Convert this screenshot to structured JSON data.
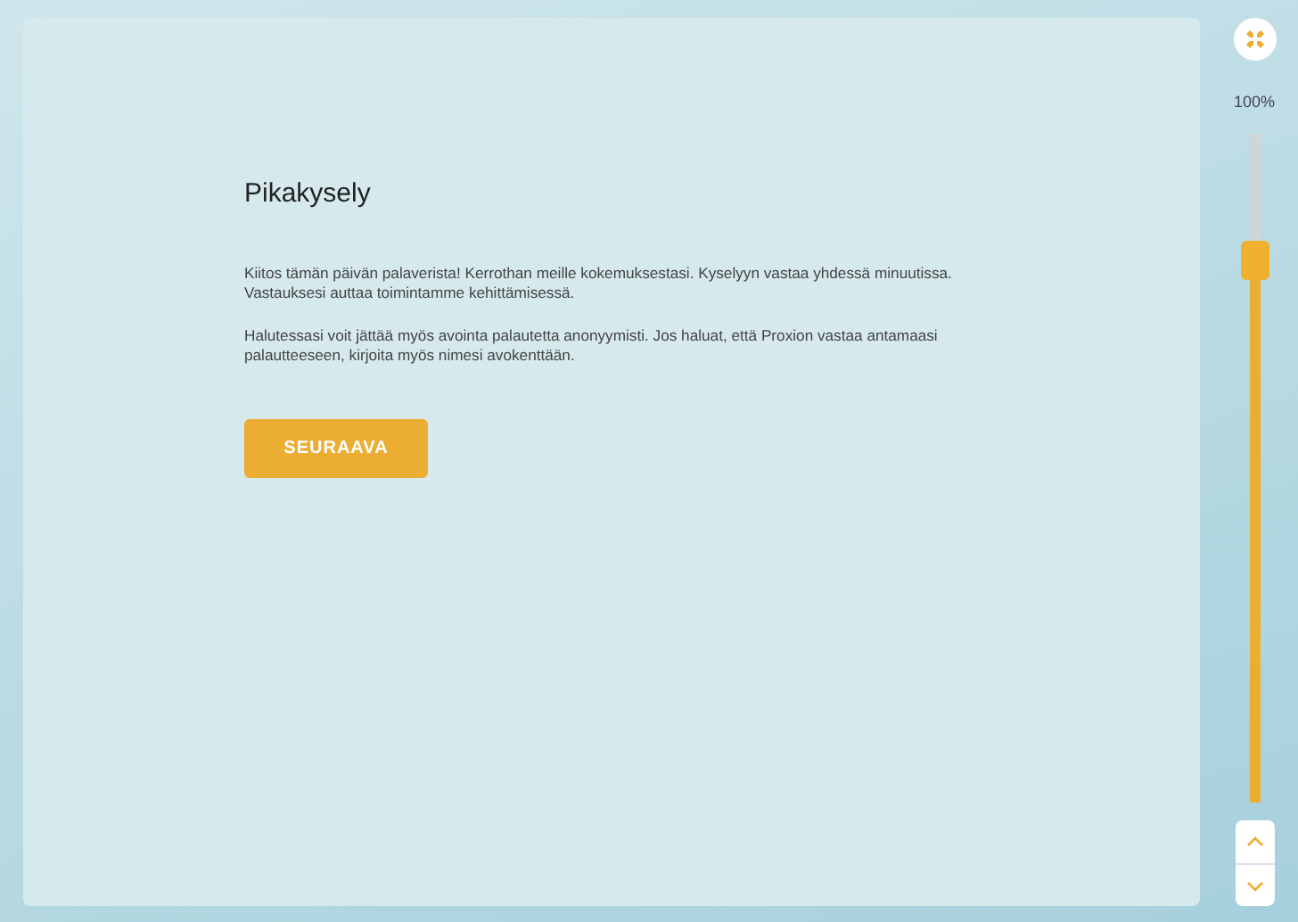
{
  "survey": {
    "title": "Pikakysely",
    "paragraphs": [
      "Kiitos tämän päivän palaverista! Kerrothan meille kokemuksestasi. Kyselyyn vastaa yhdessä minuutissa. Vastauksesi auttaa toimintamme kehittämisessä.",
      "Halutessasi voit jättää myös avointa palautetta anonyymisti. Jos haluat, että Proxion vastaa antamaasi palautteeseen, kirjoita myös nimesi avokenttään."
    ],
    "next_button": "SEURAAVA"
  },
  "zoom": {
    "reading": "100%",
    "level": 0.83
  }
}
